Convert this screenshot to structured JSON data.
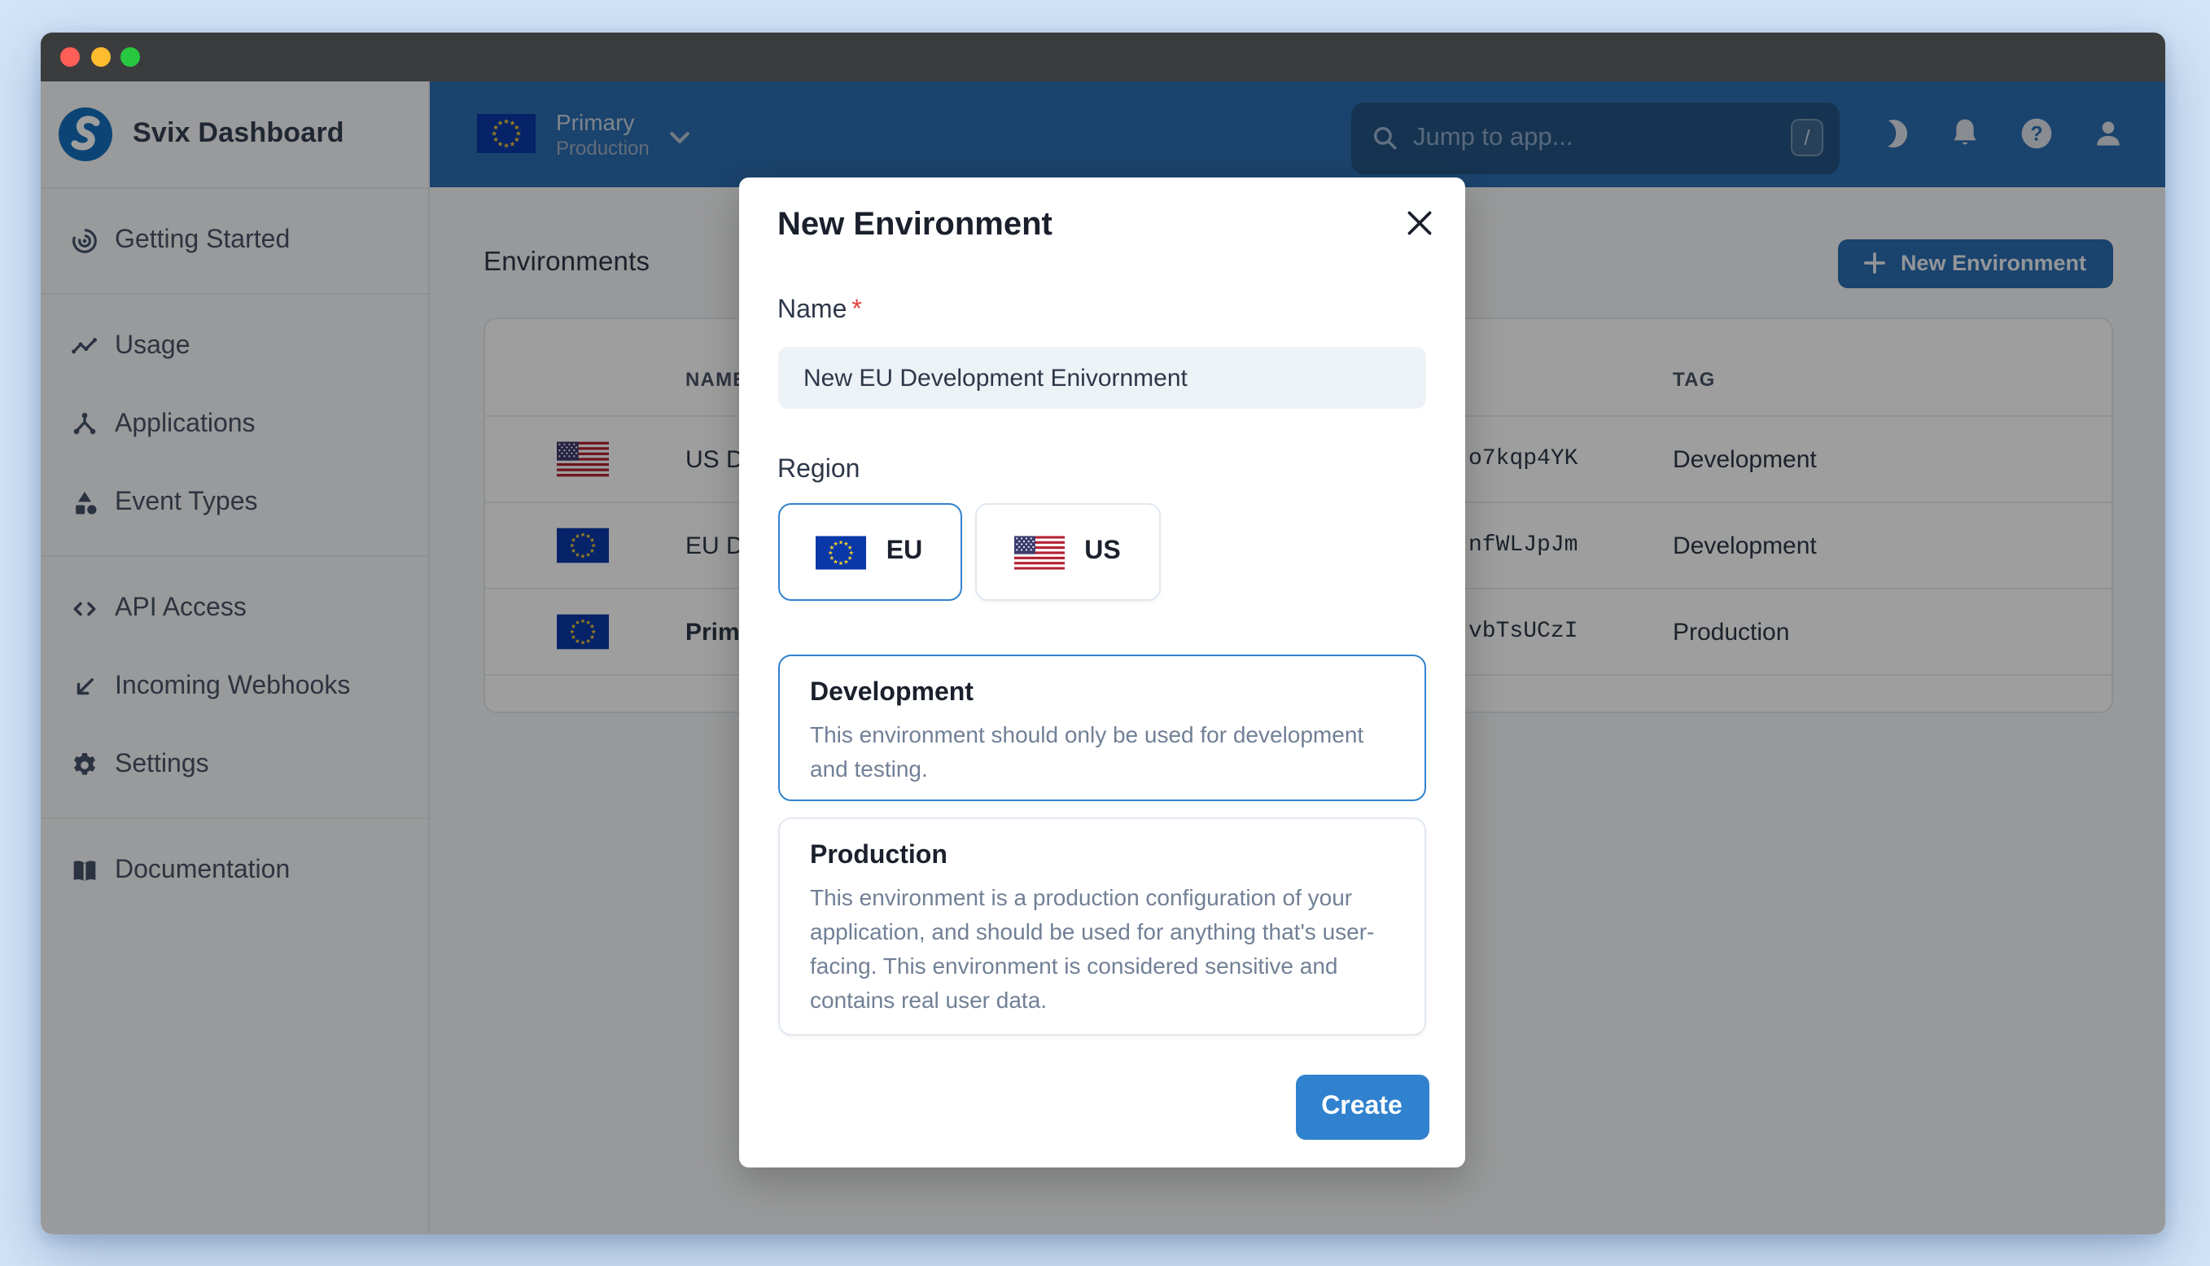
{
  "window": {
    "traffic_lights": [
      "close",
      "minimize",
      "zoom"
    ]
  },
  "sidebar": {
    "brand": "Svix Dashboard",
    "items": [
      {
        "icon": "getting-started-icon",
        "label": "Getting Started"
      },
      {
        "icon": "usage-icon",
        "label": "Usage"
      },
      {
        "icon": "applications-icon",
        "label": "Applications"
      },
      {
        "icon": "event-types-icon",
        "label": "Event Types"
      },
      {
        "icon": "api-access-icon",
        "label": "API Access"
      },
      {
        "icon": "incoming-webhooks-icon",
        "label": "Incoming Webhooks"
      },
      {
        "icon": "settings-icon",
        "label": "Settings"
      },
      {
        "icon": "documentation-icon",
        "label": "Documentation"
      }
    ]
  },
  "topbar": {
    "environment": {
      "name": "Primary",
      "mode": "Production",
      "flag": "eu"
    },
    "search": {
      "placeholder": "Jump to app...",
      "shortcut_key": "/"
    },
    "icons": [
      "dark-mode",
      "notifications",
      "help",
      "account"
    ]
  },
  "main": {
    "heading": "Environments",
    "new_environment_button": "New Environment",
    "table": {
      "columns": {
        "name": "NAME",
        "tag": "TAG"
      },
      "rows": [
        {
          "flag": "us",
          "name": "US Development",
          "id_fragment": "o7kqp4YK",
          "tag": "Development",
          "current": false
        },
        {
          "flag": "eu",
          "name": "EU Development",
          "id_fragment": "nfWLJpJm",
          "tag": "Development",
          "current": false
        },
        {
          "flag": "eu",
          "name": "Primary",
          "id_fragment": "vbTsUCzI",
          "tag": "Production",
          "current": true
        }
      ]
    }
  },
  "modal": {
    "title": "New Environment",
    "name_label": "Name",
    "required_marker": "*",
    "name_value": "New EU Development Enivornment",
    "region_label": "Region",
    "regions": [
      {
        "flag": "eu",
        "label": "EU",
        "selected": true
      },
      {
        "flag": "us",
        "label": "US",
        "selected": false
      }
    ],
    "environment_types": [
      {
        "title": "Development",
        "description_lines": [
          "This environment should only be used for development",
          "and testing."
        ],
        "selected": true
      },
      {
        "title": "Production",
        "description_lines": [
          "This environment is a production configuration of your",
          "application, and should be used for anything that's user-",
          "facing. This environment is considered sensitive and",
          "contains real user data."
        ],
        "selected": false
      }
    ],
    "create_button": "Create"
  },
  "colors": {
    "page_background": "#d2e4f8",
    "titlebar": "#3b3c3e",
    "traffic_red": "#ff5f57",
    "traffic_yellow": "#febc2e",
    "traffic_green": "#28c840",
    "topbar_blue": "#2b6cb0",
    "accent_blue": "#3182ce",
    "overlay": "rgba(0,0,0,0.38)",
    "required_red": "#e53e3e"
  }
}
